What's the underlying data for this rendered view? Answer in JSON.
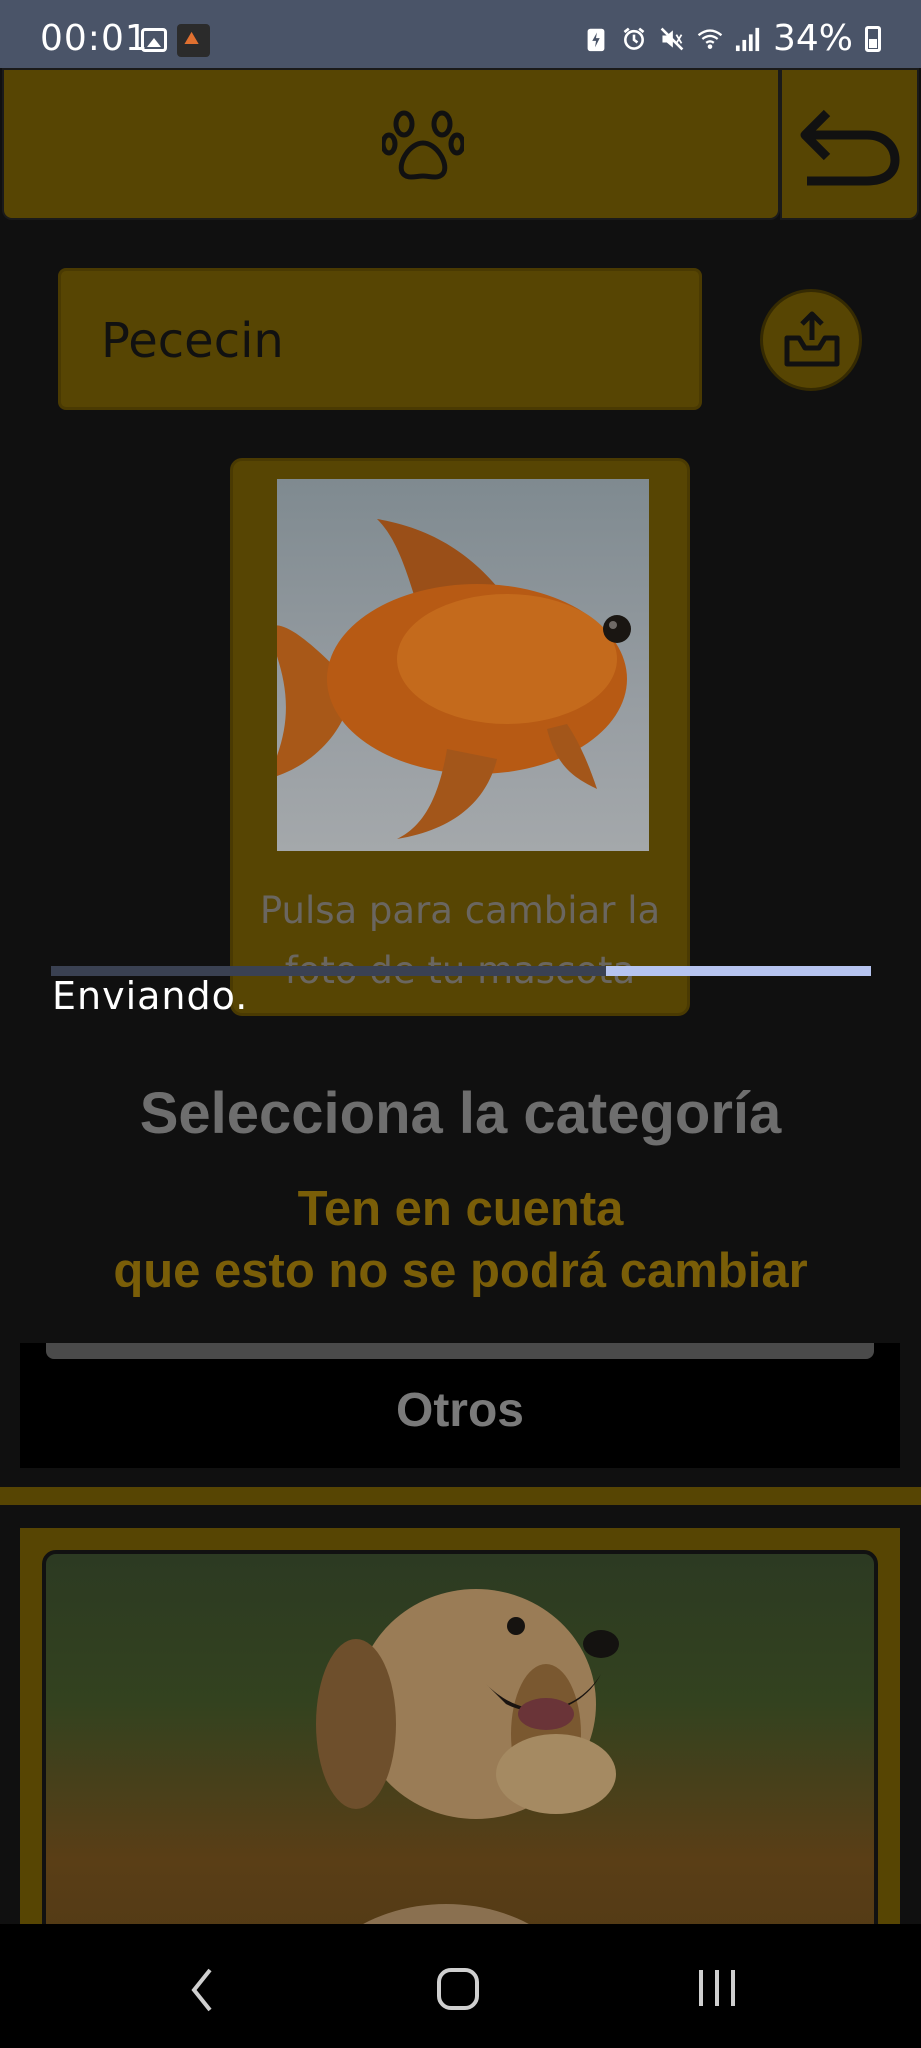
{
  "status_bar": {
    "time": "00:01",
    "battery": "34%",
    "icons": [
      "gallery-icon",
      "app-notification-icon",
      "battery-saver-icon",
      "alarm-icon",
      "mute-icon",
      "wifi-icon",
      "signal-icon",
      "battery-icon"
    ]
  },
  "top_bar": {
    "center_icon": "paw-icon",
    "back_icon": "back-arrow-icon"
  },
  "pet": {
    "name_value": "Pececin",
    "upload_icon": "upload-icon",
    "photo_hint": "Pulsa para cambiar la foto de tu mascota"
  },
  "progress": {
    "label": "Enviando.",
    "indicator": "indeterminate"
  },
  "category": {
    "title": "Selecciona la categoría",
    "warning_line1": "Ten en cuenta",
    "warning_line2": "que esto no se podrá cambiar",
    "selected": "Otros"
  },
  "colors": {
    "accent": "#574503",
    "warning_text": "#7a5e08",
    "progress": "#b6c4f0",
    "status_bar": "#4a5468"
  },
  "nav_bar": {
    "icons": [
      "nav-back-icon",
      "nav-home-icon",
      "nav-recents-icon"
    ]
  }
}
